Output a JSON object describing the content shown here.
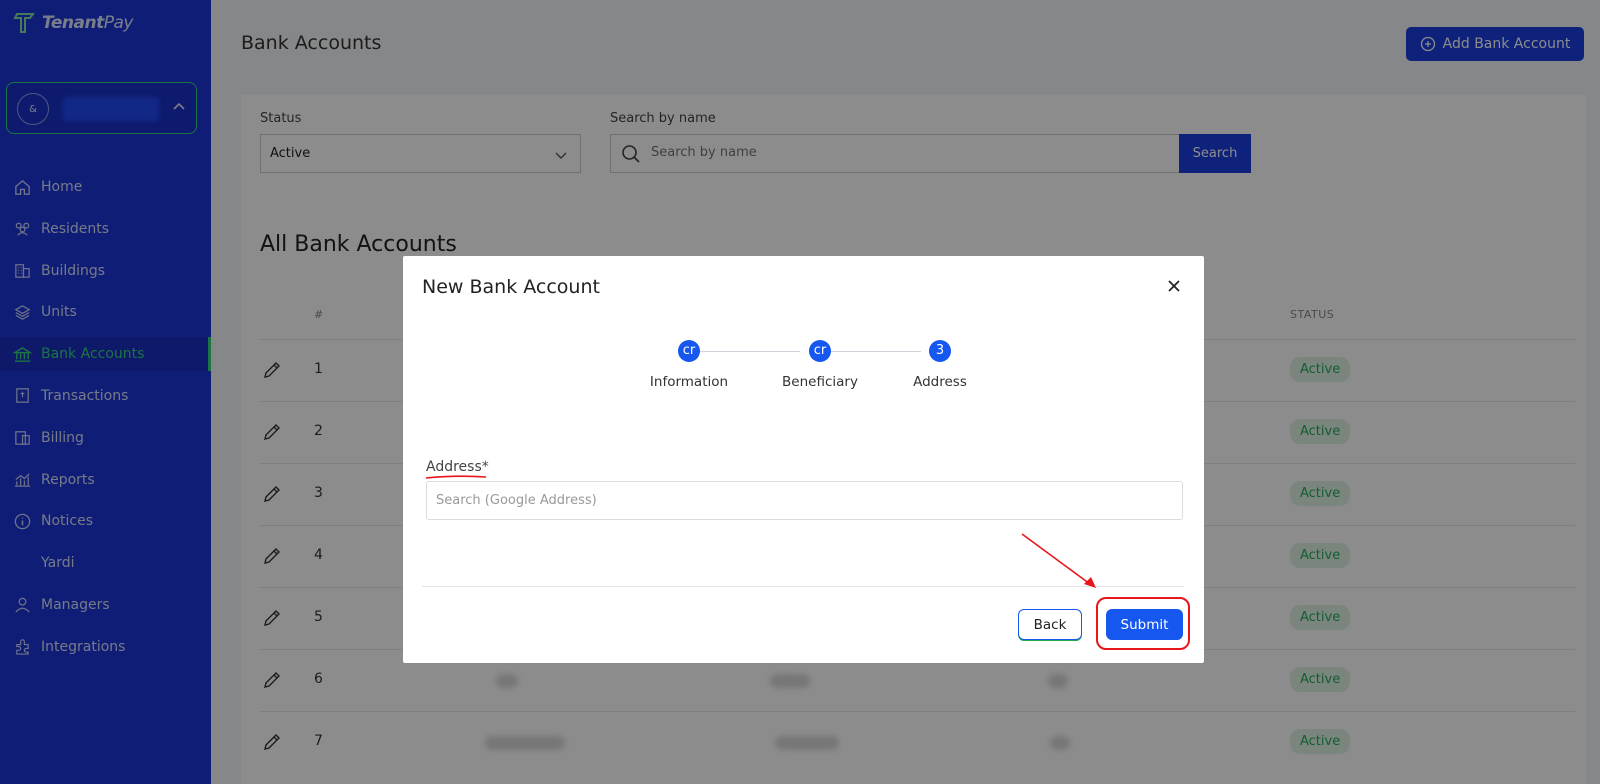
{
  "app": {
    "logo_text_a": "Tenant",
    "logo_text_b": "Pay",
    "account_avatar": "&"
  },
  "sidebar": {
    "items": [
      {
        "label": "Home",
        "icon": "home-icon"
      },
      {
        "label": "Residents",
        "icon": "residents-icon"
      },
      {
        "label": "Buildings",
        "icon": "buildings-icon"
      },
      {
        "label": "Units",
        "icon": "units-icon"
      },
      {
        "label": "Bank Accounts",
        "icon": "bank-icon",
        "active": true
      },
      {
        "label": "Transactions",
        "icon": "transactions-icon"
      },
      {
        "label": "Billing",
        "icon": "billing-icon"
      },
      {
        "label": "Reports",
        "icon": "reports-icon"
      },
      {
        "label": "Notices",
        "icon": "notices-icon"
      },
      {
        "label": "Yardi",
        "icon": ""
      },
      {
        "label": "Managers",
        "icon": "managers-icon"
      },
      {
        "label": "Integrations",
        "icon": "integrations-icon"
      }
    ]
  },
  "header": {
    "title": "Bank Accounts",
    "add_button": "Add Bank Account"
  },
  "filters": {
    "status_label": "Status",
    "status_value": "Active",
    "search_label": "Search by name",
    "search_placeholder": "Search by name",
    "search_button": "Search"
  },
  "table": {
    "title": "All Bank Accounts",
    "col_num": "#",
    "col_status": "STATUS",
    "rows": [
      {
        "num": "1",
        "status": "Active"
      },
      {
        "num": "2",
        "status": "Active"
      },
      {
        "num": "3",
        "status": "Active"
      },
      {
        "num": "4",
        "status": "Active"
      },
      {
        "num": "5",
        "status": "Active"
      },
      {
        "num": "6",
        "status": "Active"
      },
      {
        "num": "7",
        "status": "Active"
      }
    ]
  },
  "modal": {
    "title": "New Bank Account",
    "steps": [
      {
        "marker": "cr",
        "label": "Information"
      },
      {
        "marker": "cr",
        "label": "Beneficiary"
      },
      {
        "marker": "3",
        "label": "Address"
      }
    ],
    "address_label": "Address*",
    "address_placeholder": "Search (Google Address)",
    "back_button": "Back",
    "submit_button": "Submit"
  },
  "colors": {
    "sidebar": "#1d36d8",
    "accent": "#1657f0",
    "active_green": "#34d27a",
    "annotation_red": "#e8151b"
  }
}
